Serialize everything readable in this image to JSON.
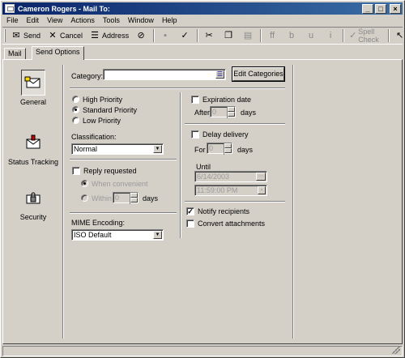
{
  "window": {
    "title": "Cameron Rogers - Mail To:"
  },
  "menu": [
    "File",
    "Edit",
    "View",
    "Actions",
    "Tools",
    "Window",
    "Help"
  ],
  "toolbar": {
    "send": "Send",
    "cancel": "Cancel",
    "address": "Address",
    "spell_check": "Spell Check",
    "overflow": "»"
  },
  "tabs": {
    "mail": "Mail",
    "send_options": "Send Options"
  },
  "sidebar": {
    "general": "General",
    "status_tracking": "Status Tracking",
    "security": "Security"
  },
  "general": {
    "category_label": "Category:",
    "category_value": "",
    "edit_categories": "Edit Categories",
    "priority": {
      "high": "High Priority",
      "standard": "Standard Priority",
      "low": "Low Priority",
      "selected": "standard"
    },
    "classification_label": "Classification:",
    "classification_value": "Normal",
    "reply_requested": "Reply requested",
    "when_convenient": "When convenient",
    "within": "Within",
    "within_value": "0",
    "days": "days",
    "mime_label": "MIME Encoding:",
    "mime_value": "ISO Default",
    "expiration_date": "Expiration date",
    "after": "After",
    "after_value": "0",
    "delay_delivery": "Delay delivery",
    "for": "For",
    "for_value": "0",
    "until": "Until",
    "until_date": "6/14/2003",
    "until_time": "11:59:00 PM",
    "notify_recipients": "Notify recipients",
    "notify_checked": true,
    "convert_attachments": "Convert attachments"
  }
}
